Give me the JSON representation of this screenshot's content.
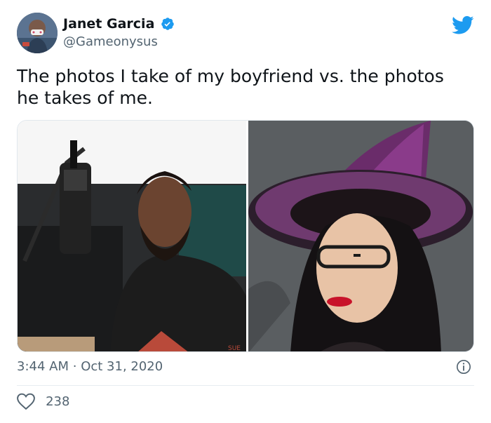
{
  "author": {
    "display_name": "Janet Garcia",
    "handle": "@Gameonysus",
    "verified": true
  },
  "tweet": {
    "text": "The photos I take of my boyfriend vs. the photos he takes of me.",
    "time": "3:44 AM",
    "separator": "·",
    "date": "Oct 31, 2020",
    "like_count": "238"
  },
  "icons": {
    "brand": "twitter-bird-icon",
    "verified": "verified-badge-icon",
    "info": "info-icon",
    "like": "heart-icon"
  },
  "colors": {
    "brand_blue": "#1d9bf0",
    "muted_text": "#536471",
    "primary_text": "#0f1419"
  }
}
